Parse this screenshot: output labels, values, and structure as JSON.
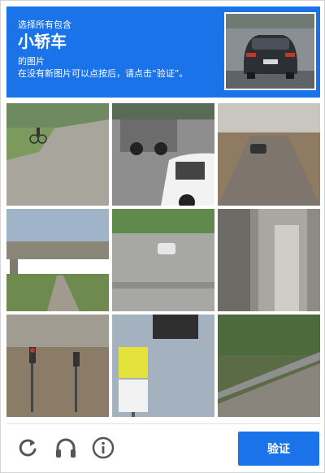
{
  "instructions": {
    "line1": "选择所有包含",
    "target": "小轿车",
    "line3": "的图片",
    "line4": "在没有新图片可以点按后，请点击“验证”。"
  },
  "footer": {
    "verify_label": "验证"
  },
  "icons": {
    "reload": "reload-icon",
    "audio": "headphones-icon",
    "info": "info-icon"
  },
  "colors": {
    "header_bg": "#1a73e8",
    "button_bg": "#1a73e8",
    "icon_gray": "#555555"
  }
}
